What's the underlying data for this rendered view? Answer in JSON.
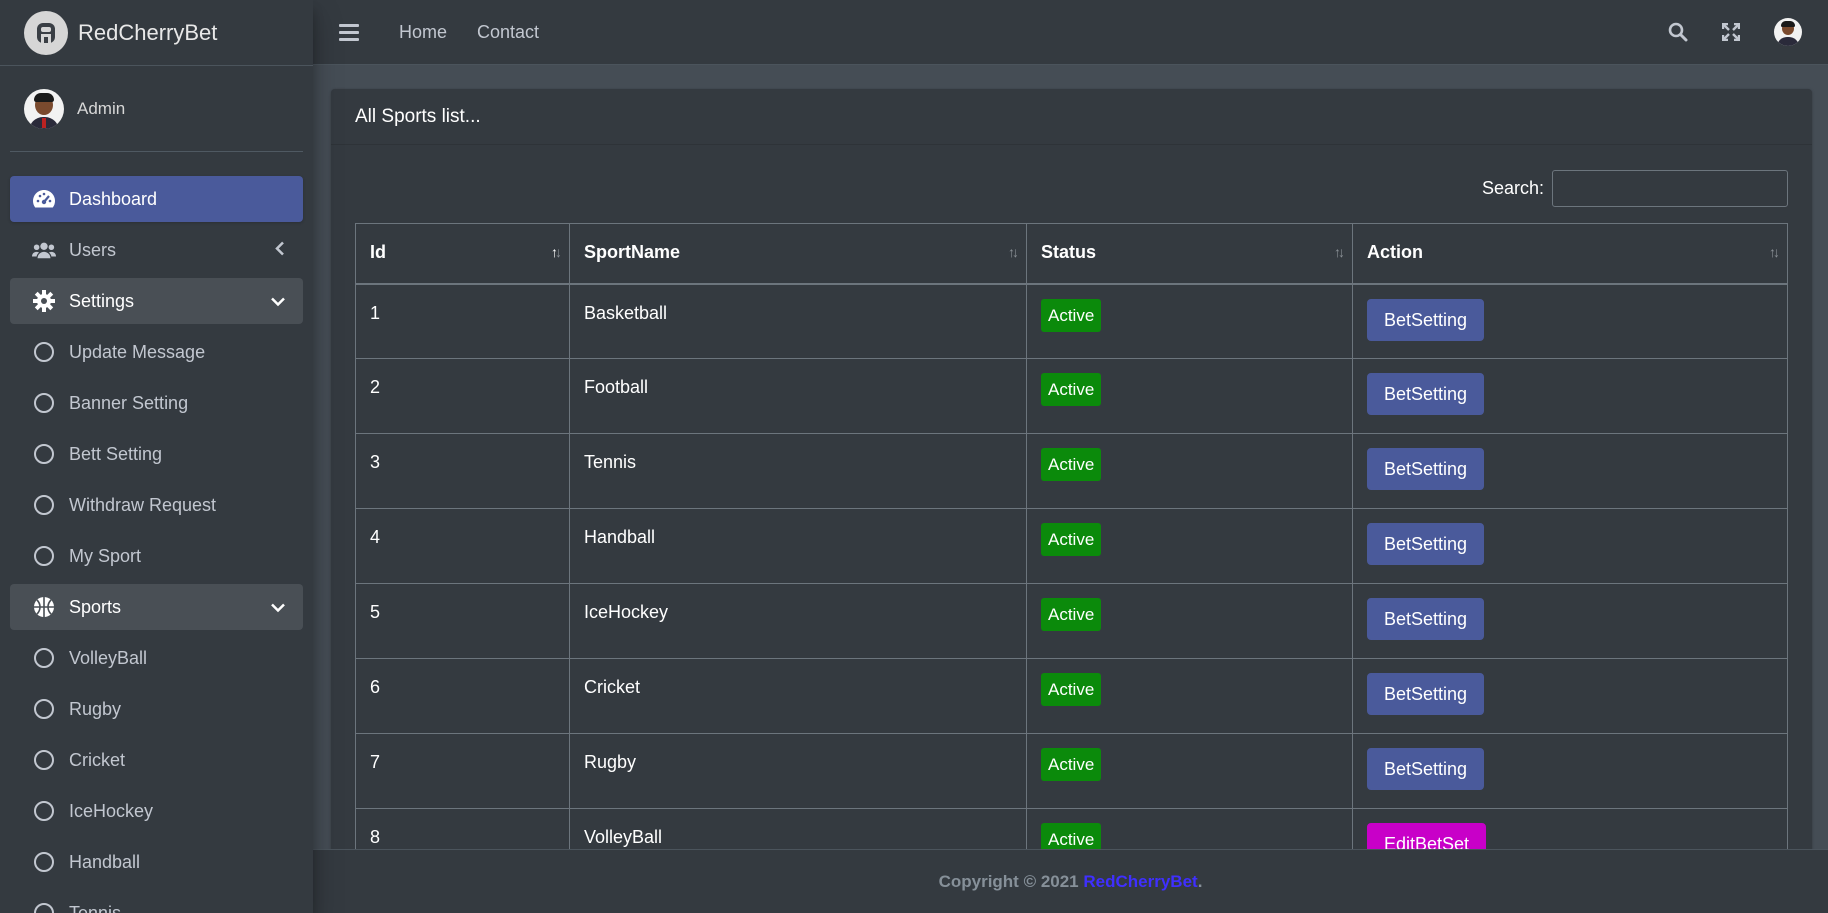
{
  "brand": {
    "name": "RedCherryBet"
  },
  "user": {
    "name": "Admin"
  },
  "sidebar": {
    "items": [
      {
        "label": "Dashboard",
        "icon": "dashboard-icon",
        "state": "active"
      },
      {
        "label": "Users",
        "icon": "users-icon",
        "state": "collapsed"
      },
      {
        "label": "Settings",
        "icon": "gear-icon",
        "state": "open"
      },
      {
        "label": "Update Message",
        "icon": "circle-icon"
      },
      {
        "label": "Banner Setting",
        "icon": "circle-icon"
      },
      {
        "label": "Bett Setting",
        "icon": "circle-icon"
      },
      {
        "label": "Withdraw Request",
        "icon": "circle-icon"
      },
      {
        "label": "My Sport",
        "icon": "circle-icon"
      },
      {
        "label": "Sports",
        "icon": "basketball-icon",
        "state": "open"
      },
      {
        "label": "VolleyBall",
        "icon": "circle-icon"
      },
      {
        "label": "Rugby",
        "icon": "circle-icon"
      },
      {
        "label": "Cricket",
        "icon": "circle-icon"
      },
      {
        "label": "IceHockey",
        "icon": "circle-icon"
      },
      {
        "label": "Handball",
        "icon": "circle-icon"
      },
      {
        "label": "Tennis",
        "icon": "circle-icon"
      }
    ]
  },
  "topbar": {
    "links": [
      "Home",
      "Contact"
    ]
  },
  "card": {
    "title": "All Sports list..."
  },
  "search": {
    "label": "Search:",
    "value": "",
    "placeholder": ""
  },
  "table": {
    "columns": [
      "Id",
      "SportName",
      "Status",
      "Action"
    ],
    "rows": [
      {
        "id": "1",
        "name": "Basketball",
        "status": "Active",
        "action": "BetSetting"
      },
      {
        "id": "2",
        "name": "Football",
        "status": "Active",
        "action": "BetSetting"
      },
      {
        "id": "3",
        "name": "Tennis",
        "status": "Active",
        "action": "BetSetting"
      },
      {
        "id": "4",
        "name": "Handball",
        "status": "Active",
        "action": "BetSetting"
      },
      {
        "id": "5",
        "name": "IceHockey",
        "status": "Active",
        "action": "BetSetting"
      },
      {
        "id": "6",
        "name": "Cricket",
        "status": "Active",
        "action": "BetSetting"
      },
      {
        "id": "7",
        "name": "Rugby",
        "status": "Active",
        "action": "BetSetting"
      },
      {
        "id": "8",
        "name": "VolleyBall",
        "status": "Active",
        "action": "EditBetSet"
      }
    ]
  },
  "footer": {
    "prefix": "Copyright © 2021 ",
    "brand": "RedCherryBet",
    "suffix": "."
  },
  "colors": {
    "sidebar_bg": "#343a40",
    "content_bg": "#454d55",
    "active_blue": "#4a5a9b",
    "status_green": "#0b8a0b",
    "edit_magenta": "#c800c8",
    "footer_link": "#3f2fff"
  }
}
